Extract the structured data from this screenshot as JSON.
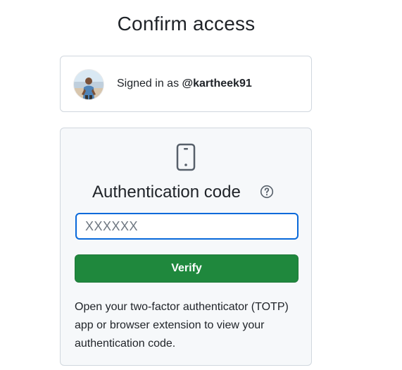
{
  "page": {
    "title": "Confirm access"
  },
  "account": {
    "signed_in_prefix": "Signed in as",
    "username": "@kartheek91",
    "avatar": "user-avatar"
  },
  "auth": {
    "device_icon": "device-mobile-icon",
    "heading": "Authentication code",
    "help_icon": "question-icon",
    "code_input": {
      "value": "",
      "placeholder": "XXXXXX"
    },
    "verify_label": "Verify",
    "help_text": "Open your two-factor authenticator (TOTP) app or browser extension to view your authentication code."
  },
  "colors": {
    "primary_button": "#1f883d",
    "focus_border": "#0969da",
    "panel_background": "#f6f8fa",
    "border": "#d0d7de"
  }
}
